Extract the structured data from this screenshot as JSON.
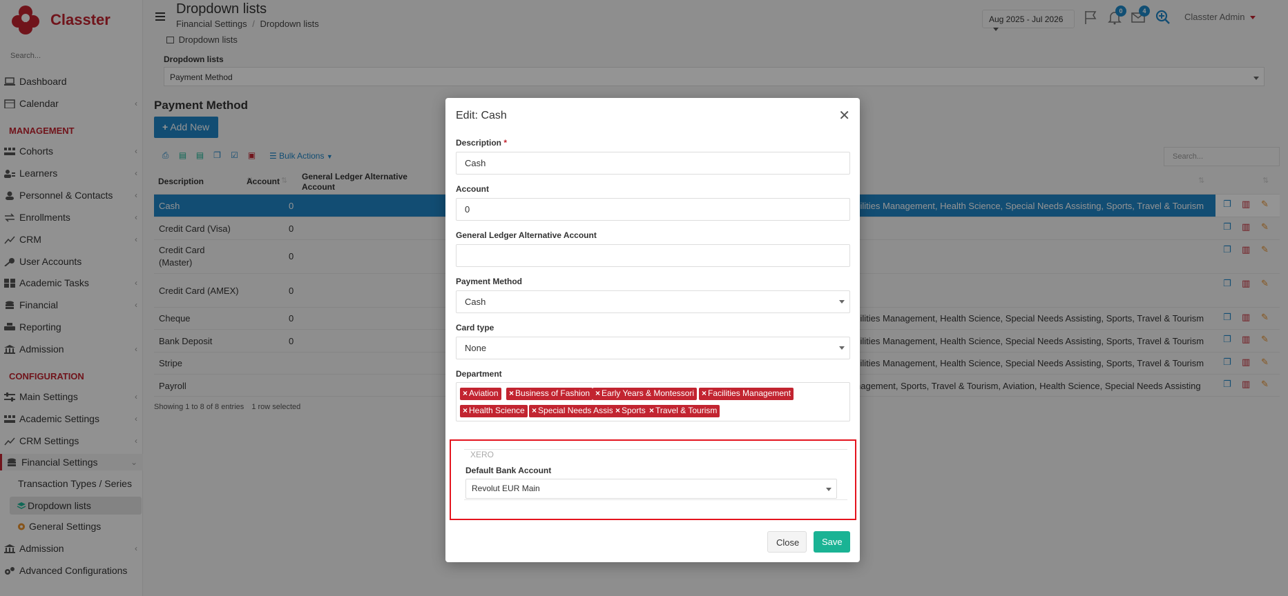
{
  "app": {
    "name": "Classter",
    "accent": "#c22430",
    "primary": "#1f85c6"
  },
  "sidebar": {
    "search_placeholder": "Search...",
    "management_title": "MANAGEMENT",
    "configuration_title": "CONFIGURATION",
    "items": [
      {
        "label": "Dashboard",
        "icon": "laptop-icon"
      },
      {
        "label": "Calendar",
        "icon": "calendar-icon"
      },
      {
        "label": "Cohorts",
        "icon": "cohorts-icon"
      },
      {
        "label": "Learners",
        "icon": "learners-icon"
      },
      {
        "label": "Personnel & Contacts",
        "icon": "person-icon"
      },
      {
        "label": "Enrollments",
        "icon": "exchange-icon"
      },
      {
        "label": "CRM",
        "icon": "crm-icon"
      },
      {
        "label": "User Accounts",
        "icon": "key-icon"
      },
      {
        "label": "Academic Tasks",
        "icon": "grid-icon"
      },
      {
        "label": "Financial",
        "icon": "database-icon"
      },
      {
        "label": "Reporting",
        "icon": "printer-icon"
      },
      {
        "label": "Admission",
        "icon": "bank-icon"
      },
      {
        "label": "Main Settings",
        "icon": "settings-icon"
      },
      {
        "label": "Academic Settings",
        "icon": "settings-icon"
      },
      {
        "label": "CRM Settings",
        "icon": "crm-icon"
      },
      {
        "label": "Financial Settings",
        "icon": "database-icon"
      },
      {
        "label": "Transaction Types / Series",
        "icon": ""
      },
      {
        "label": "Dropdown lists",
        "icon": "layers-icon"
      },
      {
        "label": "General Settings",
        "icon": "gear-icon"
      },
      {
        "label": "Admission",
        "icon": "bank-icon"
      },
      {
        "label": "Advanced Configurations",
        "icon": "gears-icon"
      }
    ]
  },
  "header": {
    "title": "Dropdown lists",
    "breadcrumb_1": "Financial Settings",
    "breadcrumb_sep": "/",
    "breadcrumb_2": "Dropdown lists",
    "year_range": "Aug 2025 - Jul 2026",
    "notifications_count": "0",
    "messages_count": "4",
    "user": "Classter Admin"
  },
  "content": {
    "tab_label": "Dropdown lists",
    "dropdown_label": "Dropdown lists",
    "dropdown_value": "Payment Method",
    "page_title": "Payment Method",
    "add_new": "Add New",
    "bulk_actions": "Bulk Actions",
    "search_placeholder": "Search...",
    "columns": {
      "description": "Description",
      "account": "Account",
      "gl_alt_1": "General Ledger Alternative",
      "gl_alt_2": "Account"
    },
    "rows": [
      {
        "description": "Cash",
        "account": "0",
        "departments": "cilities Management, Health Science, Special Needs Assisting, Sports, Travel & Tourism"
      },
      {
        "description": "Credit Card (Visa)",
        "account": "0",
        "departments": ""
      },
      {
        "description_1": "Credit Card",
        "description_2": "(Master)",
        "account": "0",
        "departments": ""
      },
      {
        "description": "Credit Card (AMEX)",
        "account": "0",
        "departments": ""
      },
      {
        "description": "Cheque",
        "account": "0",
        "departments": "cilities Management, Health Science, Special Needs Assisting, Sports, Travel & Tourism"
      },
      {
        "description": "Bank Deposit",
        "account": "0",
        "departments": "cilities Management, Health Science, Special Needs Assisting, Sports, Travel & Tourism"
      },
      {
        "description": "Stripe",
        "account": "",
        "departments": "cilities Management, Health Science, Special Needs Assisting, Sports, Travel & Tourism"
      },
      {
        "description": "Payroll",
        "account": "",
        "departments": "nagement, Sports, Travel & Tourism, Aviation, Health Science, Special Needs Assisting"
      }
    ],
    "footer_entries": "Showing 1 to 8 of 8 entries",
    "footer_selected": "1 row selected"
  },
  "modal": {
    "title": "Edit: Cash",
    "description_label": "Description",
    "required_mark": "*",
    "description_value": "Cash",
    "account_label": "Account",
    "account_value": "0",
    "gl_label": "General Ledger Alternative Account",
    "gl_value": "",
    "payment_method_label": "Payment Method",
    "payment_method_value": "Cash",
    "card_type_label": "Card type",
    "card_type_value": "None",
    "department_label": "Department",
    "departments": [
      "Aviation",
      "Business of Fashion",
      "Early Years & Montessori",
      "Facilities Management",
      "Health Science",
      "Special Needs Assisting",
      "Sports",
      "Travel & Tourism"
    ],
    "xero_legend": "XERO",
    "default_bank_label": "Default Bank Account",
    "default_bank_value": "Revolut EUR Main",
    "close_label": "Close",
    "save_label": "Save",
    "save_color": "#1ab394",
    "highlight_color": "#e4131d"
  }
}
